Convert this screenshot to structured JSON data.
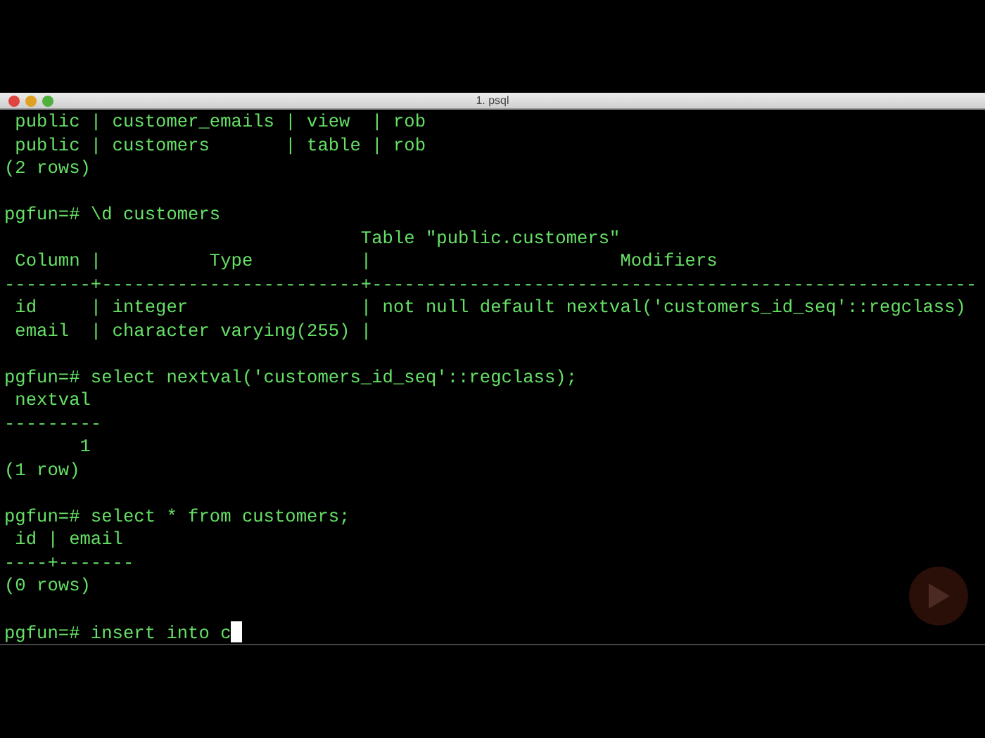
{
  "window": {
    "title": "1. psql"
  },
  "terminal": {
    "lines": [
      {
        "kind": "output",
        "text": " public | customer_emails | view  | rob"
      },
      {
        "kind": "output",
        "text": " public | customers       | table | rob"
      },
      {
        "kind": "output",
        "text": "(2 rows)"
      },
      {
        "kind": "blank"
      },
      {
        "kind": "output",
        "text": "pgfun=# \\d customers"
      },
      {
        "kind": "output",
        "text": "                                 Table \"public.customers\""
      },
      {
        "kind": "output",
        "text": " Column |          Type          |                       Modifiers"
      },
      {
        "kind": "output",
        "text": "--------+------------------------+--------------------------------------------------------"
      },
      {
        "kind": "output",
        "text": " id     | integer                | not null default nextval('customers_id_seq'::regclass)"
      },
      {
        "kind": "output",
        "text": " email  | character varying(255) |"
      },
      {
        "kind": "blank"
      },
      {
        "kind": "output",
        "text": "pgfun=# select nextval('customers_id_seq'::regclass);"
      },
      {
        "kind": "output",
        "text": " nextval"
      },
      {
        "kind": "output",
        "text": "---------"
      },
      {
        "kind": "output",
        "text": "       1"
      },
      {
        "kind": "output",
        "text": "(1 row)"
      },
      {
        "kind": "blank"
      },
      {
        "kind": "output",
        "text": "pgfun=# select * from customers;"
      },
      {
        "kind": "output",
        "text": " id | email"
      },
      {
        "kind": "output",
        "text": "----+-------"
      },
      {
        "kind": "output",
        "text": "(0 rows)"
      },
      {
        "kind": "blank"
      },
      {
        "kind": "input",
        "text": "pgfun=# insert into c"
      }
    ]
  }
}
